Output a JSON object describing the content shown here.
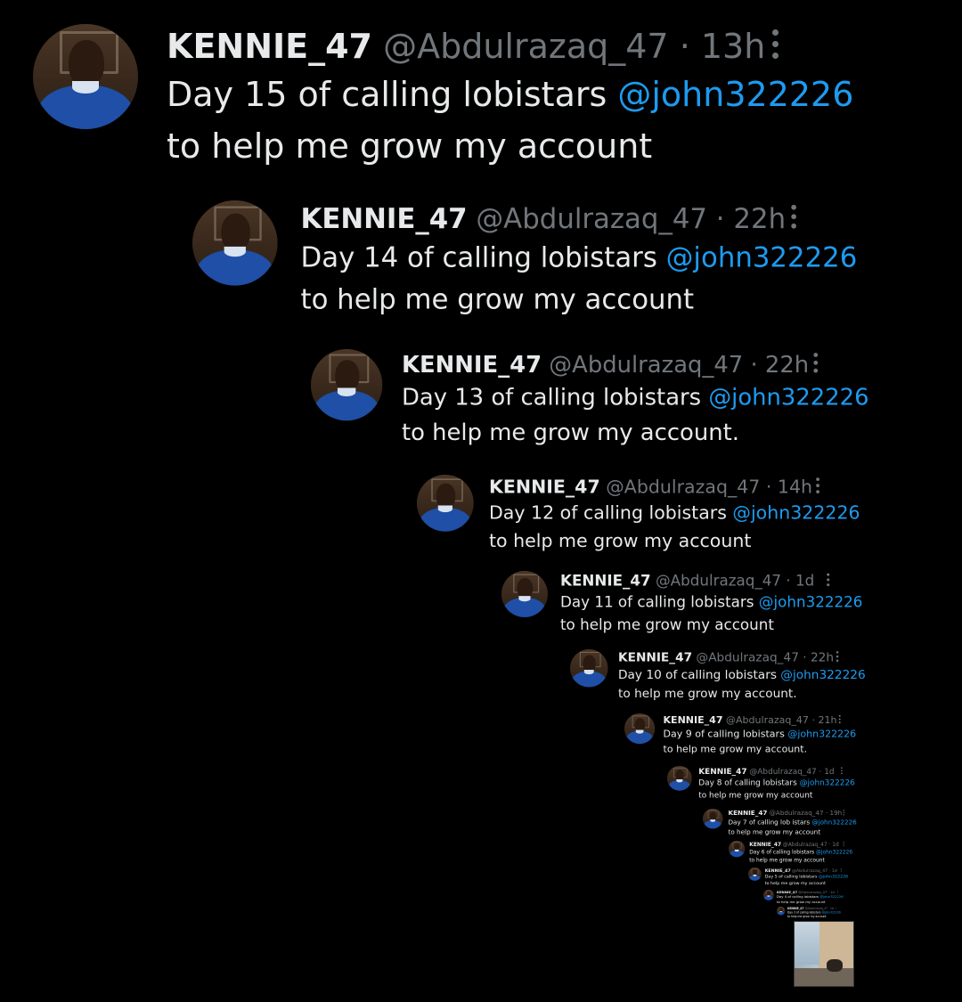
{
  "tweets": [
    {
      "display_name": "KENNIE_47",
      "handle": "@Abdulrazaq_47",
      "separator": "·",
      "time": "13h",
      "text_before": "Day 15 of calling lobistars ",
      "mention": "@john322226",
      "text_line2": "to help me grow my account"
    },
    {
      "display_name": "KENNIE_47",
      "handle": "@Abdulrazaq_47",
      "separator": "·",
      "time": "22h",
      "text_before": "Day 14 of calling lobistars ",
      "mention": "@john322226",
      "text_line2": "to help me grow my account"
    },
    {
      "display_name": "KENNIE_47",
      "handle": "@Abdulrazaq_47",
      "separator": "·",
      "time": "22h",
      "text_before": "Day 13 of calling lobistars ",
      "mention": "@john322226",
      "text_line2": "to help me grow my account."
    },
    {
      "display_name": "KENNIE_47",
      "handle": "@Abdulrazaq_47",
      "separator": "·",
      "time": "14h",
      "text_before": "Day 12 of calling lobistars ",
      "mention": "@john322226",
      "text_line2": "to help me grow my account"
    },
    {
      "display_name": "KENNIE_47",
      "handle": "@Abdulrazaq_47",
      "separator": "·",
      "time": "1d",
      "text_before": "Day 11 of calling lobistars ",
      "mention": "@john322226",
      "text_line2": "to help me grow my account"
    },
    {
      "display_name": "KENNIE_47",
      "handle": "@Abdulrazaq_47",
      "separator": "·",
      "time": "22h",
      "text_before": "Day 10 of calling lobistars ",
      "mention": "@john322226",
      "text_line2": "to help me grow my account."
    },
    {
      "display_name": "KENNIE_47",
      "handle": "@Abdulrazaq_47",
      "separator": "·",
      "time": "21h",
      "text_before": "Day 9 of calling lobistars ",
      "mention": "@john322226",
      "text_line2": "to help me grow my account."
    },
    {
      "display_name": "KENNIE_47",
      "handle": "@Abdulrazaq_47",
      "separator": "·",
      "time": "1d",
      "text_before": "Day 8 of calling lobistars ",
      "mention": "@john322226",
      "text_line2": "to help me grow my account"
    },
    {
      "display_name": "KENNIE_47",
      "handle": "@Abdulrazaq_47",
      "separator": "·",
      "time": "19h",
      "text_before": "Day 7 of calling lob istars ",
      "mention": "@john322226",
      "text_line2": "to help me grow my account"
    },
    {
      "display_name": "KENNIE_47",
      "handle": "@Abdulrazaq_47",
      "separator": "·",
      "time": "1d",
      "text_before": "Day 6 of calling lobistars ",
      "mention": "@john322226",
      "text_line2": "to help me grow my account"
    },
    {
      "display_name": "KENNIE_47",
      "handle": "@Abdulrazaq_47",
      "separator": "·",
      "time": "1d",
      "text_before": "Day 5 of calling lobistars ",
      "mention": "@john322226",
      "text_line2": "to help me grow my account"
    },
    {
      "display_name": "KENNIE_47",
      "handle": "@Abdulrazaq_47",
      "separator": "·",
      "time": "1d",
      "text_before": "Day 4 of calling lobistars ",
      "mention": "@john322226",
      "text_line2": "to help me grow my account"
    },
    {
      "display_name": "KENNIE_47",
      "handle": "@Abdulrazaq_47",
      "separator": "·",
      "time": "1d",
      "text_before": "Day 3 of calling lobistars ",
      "mention": "@john322226",
      "text_line2": "to help me grow my account"
    }
  ],
  "icons": {
    "more": "more-options-icon",
    "avatar": "avatar"
  },
  "colors": {
    "background": "#000000",
    "text": "#e7e9ea",
    "muted": "#71767b",
    "mention": "#1d9bf0"
  }
}
